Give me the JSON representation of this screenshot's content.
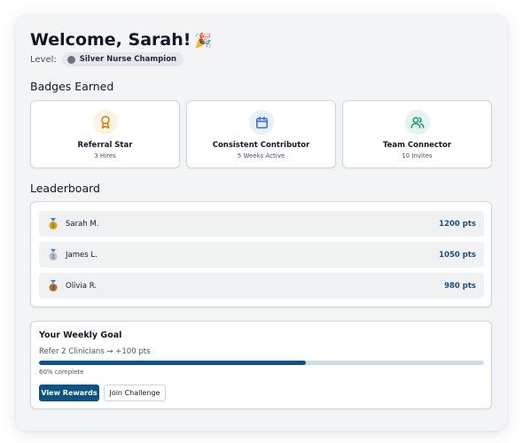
{
  "header": {
    "title": "Welcome, Sarah!",
    "title_emoji": "🎉",
    "level_label": "Level:",
    "level_value": "Silver Nurse Champion"
  },
  "badges": {
    "section_title": "Badges Earned",
    "items": [
      {
        "title": "Referral Star",
        "subtitle": "3 Hires",
        "icon": "award-ribbon-icon",
        "color": "#d97706"
      },
      {
        "title": "Consistent Contributor",
        "subtitle": "5 Weeks Active",
        "icon": "calendar-icon",
        "color": "#2563eb"
      },
      {
        "title": "Team Connector",
        "subtitle": "10 Invites",
        "icon": "users-icon",
        "color": "#059669"
      }
    ]
  },
  "leaderboard": {
    "section_title": "Leaderboard",
    "rows": [
      {
        "rank": "1",
        "name": "Sarah M.",
        "points": "1200 pts",
        "medal_color": "#d4a017"
      },
      {
        "rank": "2",
        "name": "James L.",
        "points": "1050 pts",
        "medal_color": "#b9bec8"
      },
      {
        "rank": "3",
        "name": "Olivia R.",
        "points": "980 pts",
        "medal_color": "#b0703a"
      }
    ]
  },
  "goal": {
    "title": "Your Weekly Goal",
    "description": "Refer 2 Clinicians → +100 pts",
    "progress_percent": 60,
    "progress_label": "60% complete",
    "primary_button": "View Rewards",
    "secondary_button": "Join Challenge"
  },
  "colors": {
    "accent": "#0e5283",
    "points_text": "#1d4f7a"
  }
}
